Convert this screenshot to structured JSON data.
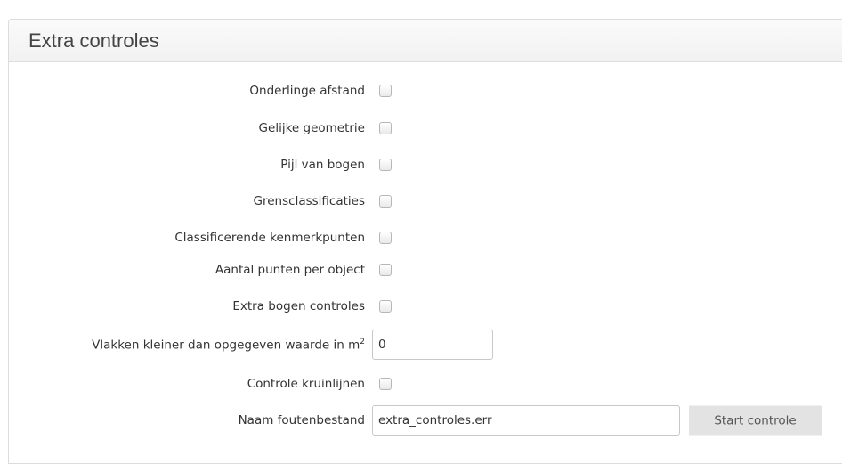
{
  "panel": {
    "title": "Extra controles"
  },
  "fields": {
    "onderlinge_afstand": {
      "label": "Onderlinge afstand",
      "checked": false
    },
    "gelijke_geometrie": {
      "label": "Gelijke geometrie",
      "checked": false
    },
    "pijl_van_bogen": {
      "label": "Pijl van bogen",
      "checked": false
    },
    "grensclassificaties": {
      "label": "Grensclassificaties",
      "checked": false
    },
    "classificerende_kenmerkpunten": {
      "label": "Classificerende kenmerkpunten",
      "checked": false
    },
    "aantal_punten_per_object": {
      "label": "Aantal punten per object",
      "checked": false
    },
    "extra_bogen_controles": {
      "label": "Extra bogen controles",
      "checked": false
    },
    "vlakken_kleiner": {
      "label": "Vlakken kleiner dan opgegeven waarde in m",
      "label_sup": "2",
      "value": "0"
    },
    "controle_kruinlijnen": {
      "label": "Controle kruinlijnen",
      "checked": false
    },
    "naam_foutenbestand": {
      "label": "Naam foutenbestand",
      "value": "extra_controles.err"
    }
  },
  "actions": {
    "start_label": "Start controle"
  }
}
